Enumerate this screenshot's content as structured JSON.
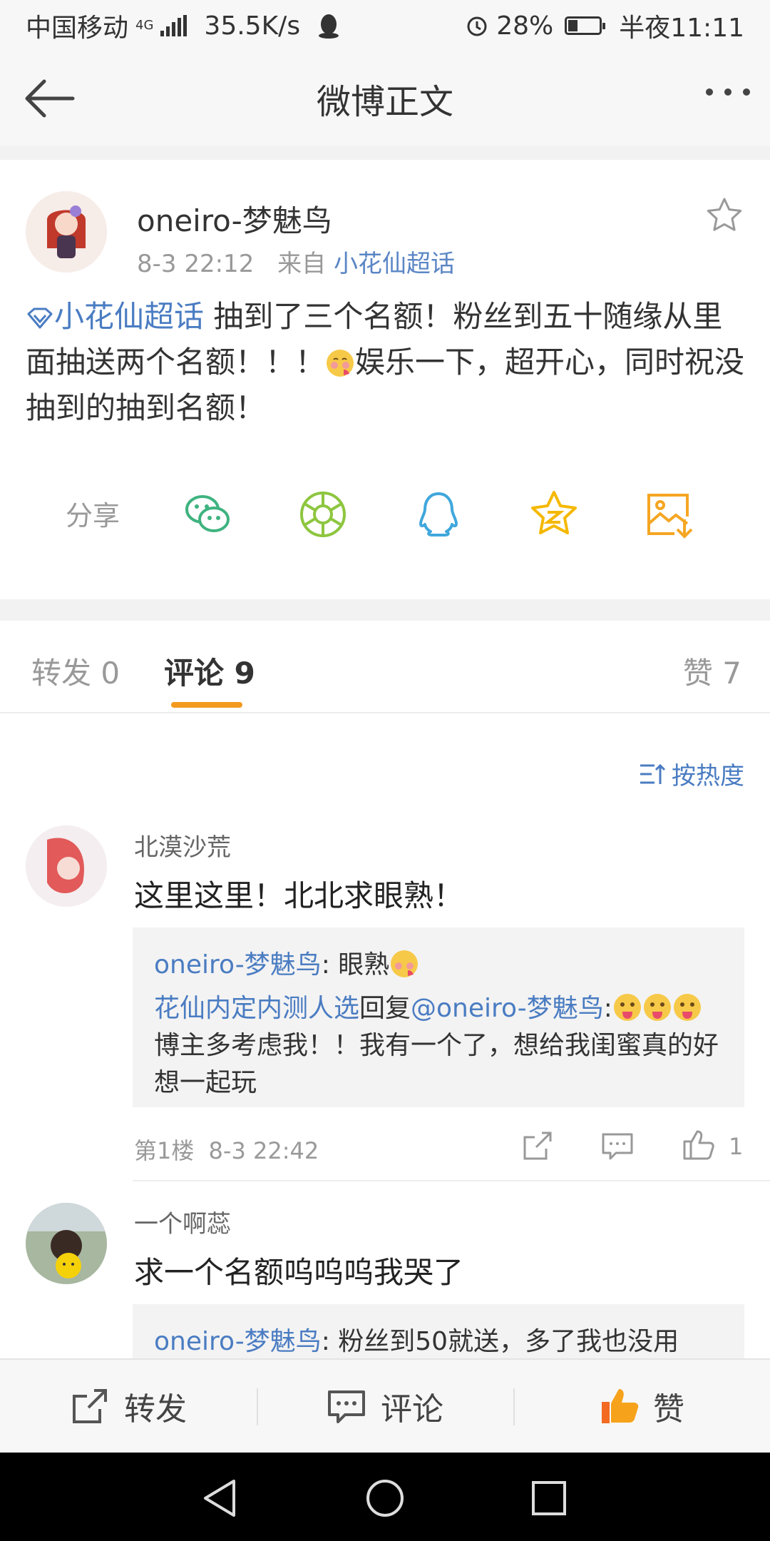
{
  "status_bar": {
    "carrier": "中国移动",
    "network": "4G",
    "speed": "35.5K/s",
    "battery": "28%",
    "battery_level": 0.28,
    "time": "半夜11:11"
  },
  "nav": {
    "title": "微博正文",
    "back_icon": "arrow-left-icon",
    "more_icon": "more-dots-icon"
  },
  "post": {
    "author": "oneiro-梦魅鸟",
    "time": "8-3 22:12",
    "from_label": "来自",
    "source": "小花仙超话",
    "topic": "小花仙超话",
    "text_a": " 抽到了三个名额！粉丝到五十随缘从里面抽送两个名额！！！",
    "text_b": "娱乐一下，超开心，同时祝没抽到的抽到名额！",
    "share_label": "分享",
    "share_icons": [
      "wechat-icon",
      "moments-icon",
      "qq-icon",
      "qzone-icon",
      "save-image-icon"
    ]
  },
  "tabs": {
    "repost": "转发 0",
    "comments": "评论 9",
    "likes": "赞 7"
  },
  "sort_label": "按热度",
  "comments": [
    {
      "name": "北漠沙荒",
      "text": "这里这里！北北求眼熟！",
      "replies": [
        {
          "user": "oneiro-梦魅鸟",
          "text": ": 眼熟"
        },
        {
          "user": "花仙内定内测人选",
          "mid": "回复",
          "mention": "@oneiro-梦魅鸟",
          "text": ":",
          "cont": "博主多考虑我！！我有一个了，想给我闺蜜真的好想一起玩"
        }
      ],
      "floor": "第1楼",
      "time": "8-3 22:42",
      "likes": "1"
    },
    {
      "name": "一个啊蕊",
      "text": "求一个名额呜呜呜我哭了",
      "replies": [
        {
          "user": "oneiro-梦魅鸟",
          "text": ": 粉丝到50就送，多了我也没用"
        }
      ]
    }
  ],
  "bottom_bar": {
    "repost": "转发",
    "comment": "评论",
    "like": "赞"
  },
  "colors": {
    "link": "#4a7cc2",
    "accent": "#f39a1e"
  }
}
